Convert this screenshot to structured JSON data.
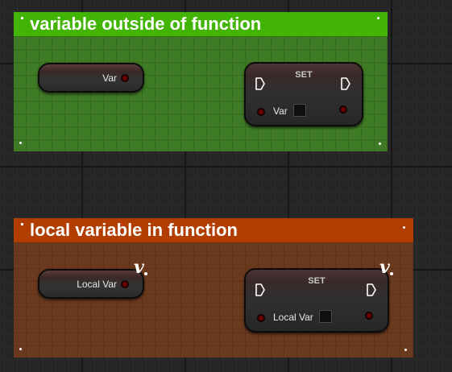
{
  "comments": [
    {
      "title": "variable outside of function",
      "color": "#42b403",
      "getter": {
        "label": "Var"
      },
      "setter": {
        "title": "SET",
        "pin_label": "Var"
      }
    },
    {
      "title": "local variable in function",
      "color": "#b13d00",
      "getter": {
        "label": "Local Var",
        "local_badge": "v"
      },
      "setter": {
        "title": "SET",
        "pin_label": "Local Var",
        "local_badge": "v"
      }
    }
  ],
  "colors": {
    "background": "#262626",
    "pin_fill": "#6b0000",
    "green_body": "#3f7a25",
    "orange_body": "#6b3a1e"
  },
  "icons": [
    "exec-pin-icon",
    "data-pin-icon",
    "local-variable-icon"
  ]
}
